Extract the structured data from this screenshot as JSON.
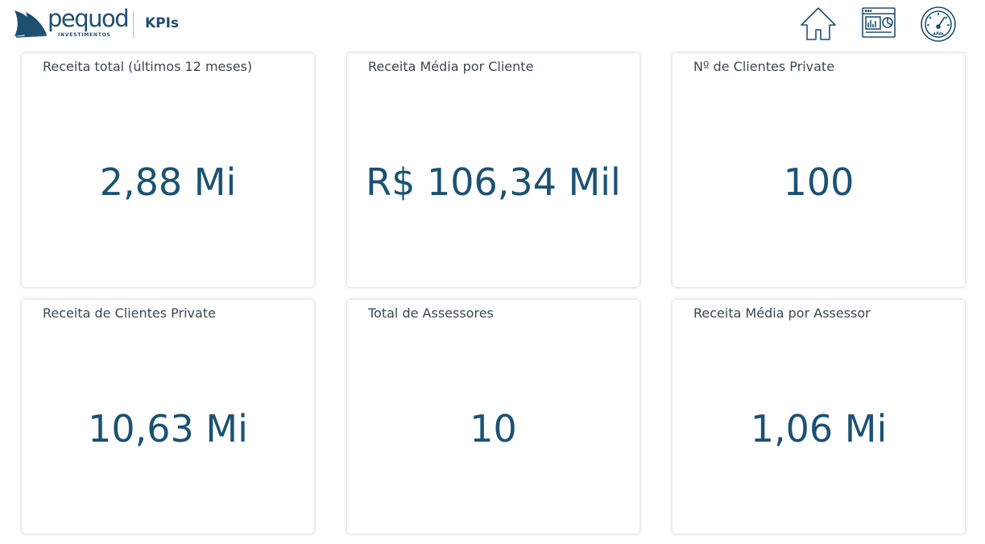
{
  "header": {
    "logo_text": "pequod",
    "logo_subtext": "INVESTIMENTOS",
    "page_title": "KPIs"
  },
  "nav": {
    "icons": [
      "home-icon",
      "dashboard-report-icon",
      "kpi-gauge-icon"
    ]
  },
  "colors": {
    "brand": "#1e4f6f",
    "value_text": "#1a5274",
    "title_text": "#3b4850",
    "background": "#ffffff"
  },
  "kpis": [
    {
      "title": "Receita total (últimos 12 meses)",
      "value": "2,88 Mi"
    },
    {
      "title": "Receita Média por Cliente",
      "value": "R$ 106,34 Mil"
    },
    {
      "title": "Nº de Clientes Private",
      "value": "100"
    },
    {
      "title": "Receita de Clientes Private",
      "value": "10,63 Mi"
    },
    {
      "title": "Total de Assessores",
      "value": "10"
    },
    {
      "title": "Receita Média por Assessor",
      "value": "1,06 Mi"
    }
  ]
}
